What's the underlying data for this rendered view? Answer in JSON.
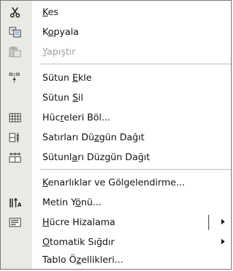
{
  "menu": {
    "items": [
      {
        "name": "menu-item-cut",
        "pre": "",
        "u": "K",
        "post": "es",
        "icon": "scissors-icon",
        "disabled": false
      },
      {
        "name": "menu-item-copy",
        "pre": "K",
        "u": "o",
        "post": "pyala",
        "icon": "copy-icon",
        "disabled": false
      },
      {
        "name": "menu-item-paste",
        "pre": "",
        "u": "Y",
        "post": "apıştır",
        "icon": "paste-icon",
        "disabled": true
      },
      {
        "name": "menu-item-insert-column",
        "pre": "Sütun ",
        "u": "E",
        "post": "kle",
        "icon": "insert-column-icon",
        "disabled": false
      },
      {
        "name": "menu-item-delete-column",
        "pre": "Sütun ",
        "u": "S",
        "post": "il",
        "icon": "",
        "disabled": false
      },
      {
        "name": "menu-item-split-cells",
        "pre": "Hüc",
        "u": "r",
        "post": "eleri Böl...",
        "icon": "split-cells-icon",
        "disabled": false
      },
      {
        "name": "menu-item-distribute-rows",
        "pre": "Satırları Dü",
        "u": "z",
        "post": "gün Dağıt",
        "icon": "distribute-rows-icon",
        "disabled": false
      },
      {
        "name": "menu-item-distribute-columns",
        "pre": "Sütunl",
        "u": "a",
        "post": "rı Düzgün Dağıt",
        "icon": "distribute-columns-icon",
        "disabled": false
      },
      {
        "name": "menu-item-borders-shading",
        "pre": "",
        "u": "K",
        "post": "enarlıklar ve Gölgelendirme...",
        "icon": "",
        "disabled": false
      },
      {
        "name": "menu-item-text-direction",
        "pre": "Metin Y",
        "u": "ö",
        "post": "nü...",
        "icon": "text-direction-icon",
        "disabled": false
      },
      {
        "name": "menu-item-cell-alignment",
        "pre": "",
        "u": "H",
        "post": "ücre Hizalama",
        "icon": "cell-alignment-icon",
        "disabled": false
      },
      {
        "name": "menu-item-autofit",
        "pre": "",
        "u": "O",
        "post": "tomatik Sığdır",
        "icon": "",
        "disabled": false
      },
      {
        "name": "menu-item-table-properties",
        "pre": "Tablo Ö",
        "u": "z",
        "post": "ellikleri...",
        "icon": "",
        "disabled": false
      }
    ]
  }
}
